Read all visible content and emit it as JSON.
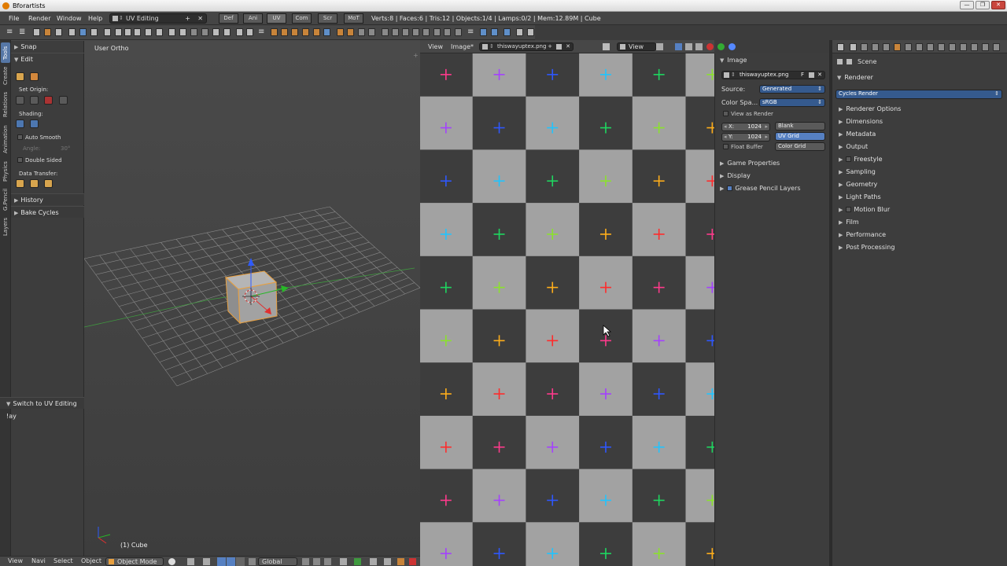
{
  "window": {
    "title": "Bforartists"
  },
  "menu": {
    "items": [
      "File",
      "Render",
      "Window",
      "Help"
    ],
    "layout_name": "UV Editing",
    "screen_tabs": [
      "Def",
      "Ani",
      "UV",
      "Com",
      "Scr",
      "MoT"
    ],
    "stats": "Verts:8 | Faces:6 | Tris:12 | Objects:1/4 | Lamps:0/2 | Mem:12.89M | Cube"
  },
  "tool_shelf": {
    "tabs": [
      "Tools",
      "Create",
      "Relations",
      "Animation",
      "Physics",
      "Grease Pencil",
      "Layers"
    ],
    "active_tab": "Tools",
    "snap": "Snap",
    "edit": "Edit",
    "set_origin": "Set Origin:",
    "shading": "Shading:",
    "auto_smooth": "Auto Smooth",
    "angle_label": "Angle:",
    "angle_value": "30°",
    "double_sided": "Double Sided",
    "data_transfer": "Data Transfer:",
    "history": "History",
    "bake_cycles": "Bake Cycles",
    "last_op": "Switch to UV Editing !ay"
  },
  "viewport": {
    "view_label": "User Ortho",
    "object_label": "(1) Cube"
  },
  "bottom_bar": {
    "menus": [
      "View",
      "Navi",
      "Select",
      "Object"
    ],
    "mode": "Object Mode",
    "orientation": "Global"
  },
  "uv_editor": {
    "menus": [
      "View",
      "Image*"
    ],
    "image_name": "thiswayuptex.png",
    "view_btn": "View"
  },
  "image_panel": {
    "title": "Image",
    "image_name": "thiswayuptex.png",
    "fake_user": "F",
    "source_label": "Source:",
    "source_value": "Generated",
    "colorspace_label": "Color Spa...",
    "colorspace_value": "sRGB",
    "view_as_render": "View as Render",
    "x_label": "X:",
    "x_value": "1024",
    "y_label": "Y:",
    "y_value": "1024",
    "float_buffer": "Float Buffer",
    "types": [
      "Blank",
      "UV Grid",
      "Color Grid"
    ],
    "active_type": "UV Grid",
    "sections": [
      "Game Properties",
      "Display",
      "Grease Pencil Layers"
    ]
  },
  "properties": {
    "context": "Scene",
    "renderer_section": "Renderer",
    "engine": "Cycles Render",
    "panels": [
      "Renderer Options",
      "Dimensions",
      "Metadata",
      "Output",
      "Freestyle",
      "Sampling",
      "Geometry",
      "Light Paths",
      "Motion Blur",
      "Film",
      "Performance",
      "Post Processing"
    ]
  },
  "colors": {
    "uv_light": "#a2a2a2",
    "uv_dark": "#3d3d3d",
    "cross_colors": [
      "#ff3a8c",
      "#a440ff",
      "#2e57ff",
      "#20c4ff",
      "#1ed760",
      "#8ae22c",
      "#ffae1a",
      "#ff2b2b"
    ],
    "accent": "#5680c2"
  }
}
